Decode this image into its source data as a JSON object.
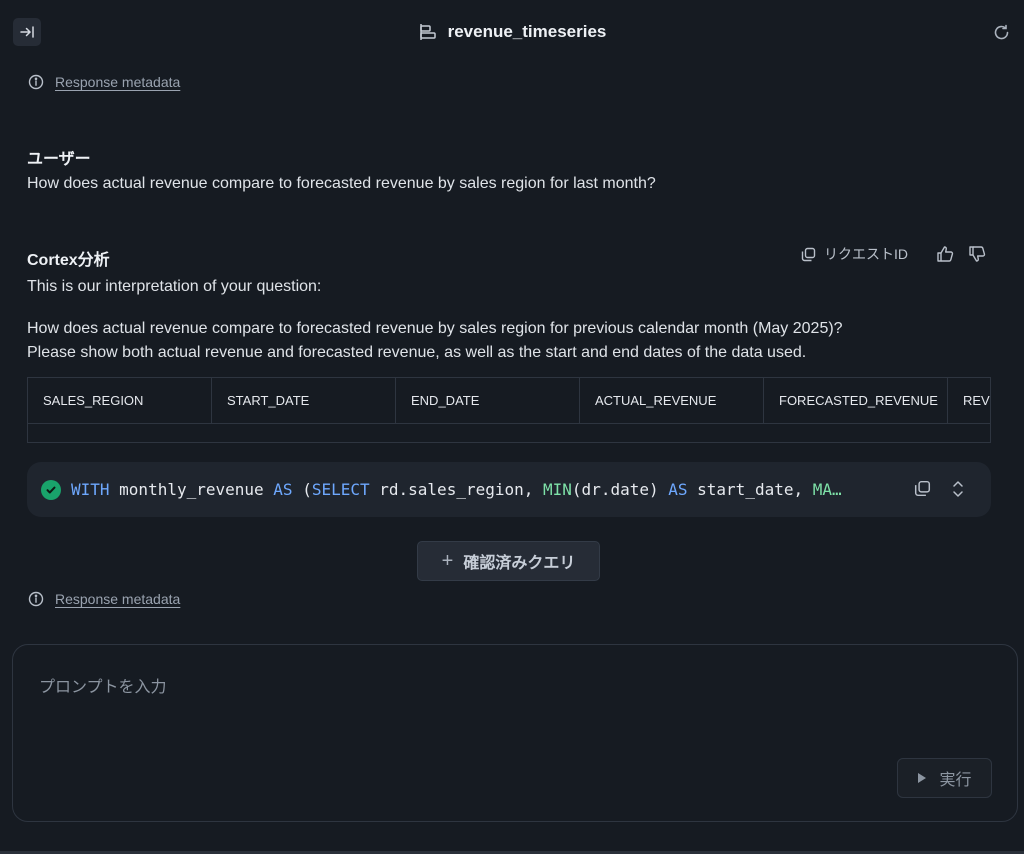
{
  "header": {
    "title": "revenue_timeseries",
    "collapse_icon": "panel-collapse-icon",
    "table_icon": "semantic-model-icon",
    "refresh_icon": "refresh-icon"
  },
  "metadata_top": {
    "label": "Response metadata"
  },
  "user_message": {
    "author": "ユーザー",
    "text": "How does actual revenue compare to forecasted revenue by sales region for last month?"
  },
  "assistant_message": {
    "author": "Cortex分析",
    "request_id_label": "リクエストID",
    "intro": "This is our interpretation of your question:",
    "interpretation_line1": "How does actual revenue compare to forecasted revenue by sales region for previous calendar month (May 2025)?",
    "interpretation_line2": "Please show both actual revenue and forecasted revenue, as well as the start and end dates of the data used."
  },
  "result_table": {
    "columns": [
      "SALES_REGION",
      "START_DATE",
      "END_DATE",
      "ACTUAL_REVENUE",
      "FORECASTED_REVENUE",
      "REV"
    ]
  },
  "sql": {
    "tokens": [
      {
        "t": "WITH",
        "c": "kw"
      },
      {
        "t": " monthly_revenue ",
        "c": ""
      },
      {
        "t": "AS",
        "c": "kw"
      },
      {
        "t": " (",
        "c": ""
      },
      {
        "t": "SELECT",
        "c": "kw"
      },
      {
        "t": " rd.sales_region, ",
        "c": ""
      },
      {
        "t": "MIN",
        "c": "fn"
      },
      {
        "t": "(dr.date) ",
        "c": ""
      },
      {
        "t": "AS",
        "c": "kw"
      },
      {
        "t": " start_date, ",
        "c": ""
      },
      {
        "t": "MA…",
        "c": "fn"
      }
    ],
    "status": "verified"
  },
  "verified_query_button": {
    "label": "確認済みクエリ"
  },
  "metadata_bottom": {
    "label": "Response metadata"
  },
  "prompt": {
    "placeholder": "プロンプトを入力",
    "run_label": "実行"
  },
  "colors": {
    "background": "#161b22",
    "keyword": "#6ea8fe",
    "function": "#7ee2a8",
    "success": "#19a36b"
  }
}
